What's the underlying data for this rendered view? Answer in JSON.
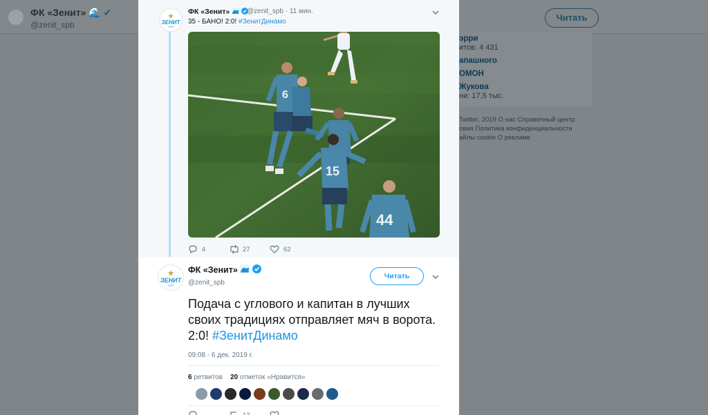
{
  "background": {
    "profile_name": "ФК «Зенит»",
    "profile_handle": "@zenit_spb",
    "follow_label": "Читать",
    "card_lines": [
      "эрри",
      "итов: 4 431",
      "апашного",
      "ОМОН",
      "Жукова",
      "ни: 17,5 тыс."
    ],
    "footer_lines": [
      "Twitter, 2019   О нас   Справочный центр",
      "овия   Политика конфиденциальности",
      "айлы cookie   О рекламе"
    ]
  },
  "tweet1": {
    "name": "ФК «Зенит»",
    "handle": "@zenit_spb",
    "time": "11 мин.",
    "text": "35 - БАНО! 2:0! ",
    "hashtag": "#ЗенитДинамо",
    "replies": "4",
    "retweets": "27",
    "likes": "62"
  },
  "tweet2": {
    "name": "ФК «Зенит»",
    "handle": "@zenit_spb",
    "follow_label": "Читать",
    "text": "Подача с углового и капитан в лучших своих традициях отправляет мяч в ворота. 2:0! ",
    "hashtag": "#ЗенитДинамо",
    "datetime": "09:08 - 6 дек. 2019 г.",
    "retweets_count": "6",
    "retweets_label": "ретвитов",
    "likes_count": "20",
    "likes_label": "отметок «Нравится»",
    "liker_colors": [
      "#8a9ba8",
      "#1d3c6e",
      "#2a2a2a",
      "#0b1a3a",
      "#7a3b1e",
      "#3a5a2a",
      "#4a4a4a",
      "#1a2a4a",
      "#6a6a6a",
      "#1d5c8c"
    ],
    "bottom_counts": [
      "",
      "13",
      ""
    ]
  },
  "colors": {
    "accent": "#1da1f2",
    "zenit_blue": "#1d93cf"
  }
}
